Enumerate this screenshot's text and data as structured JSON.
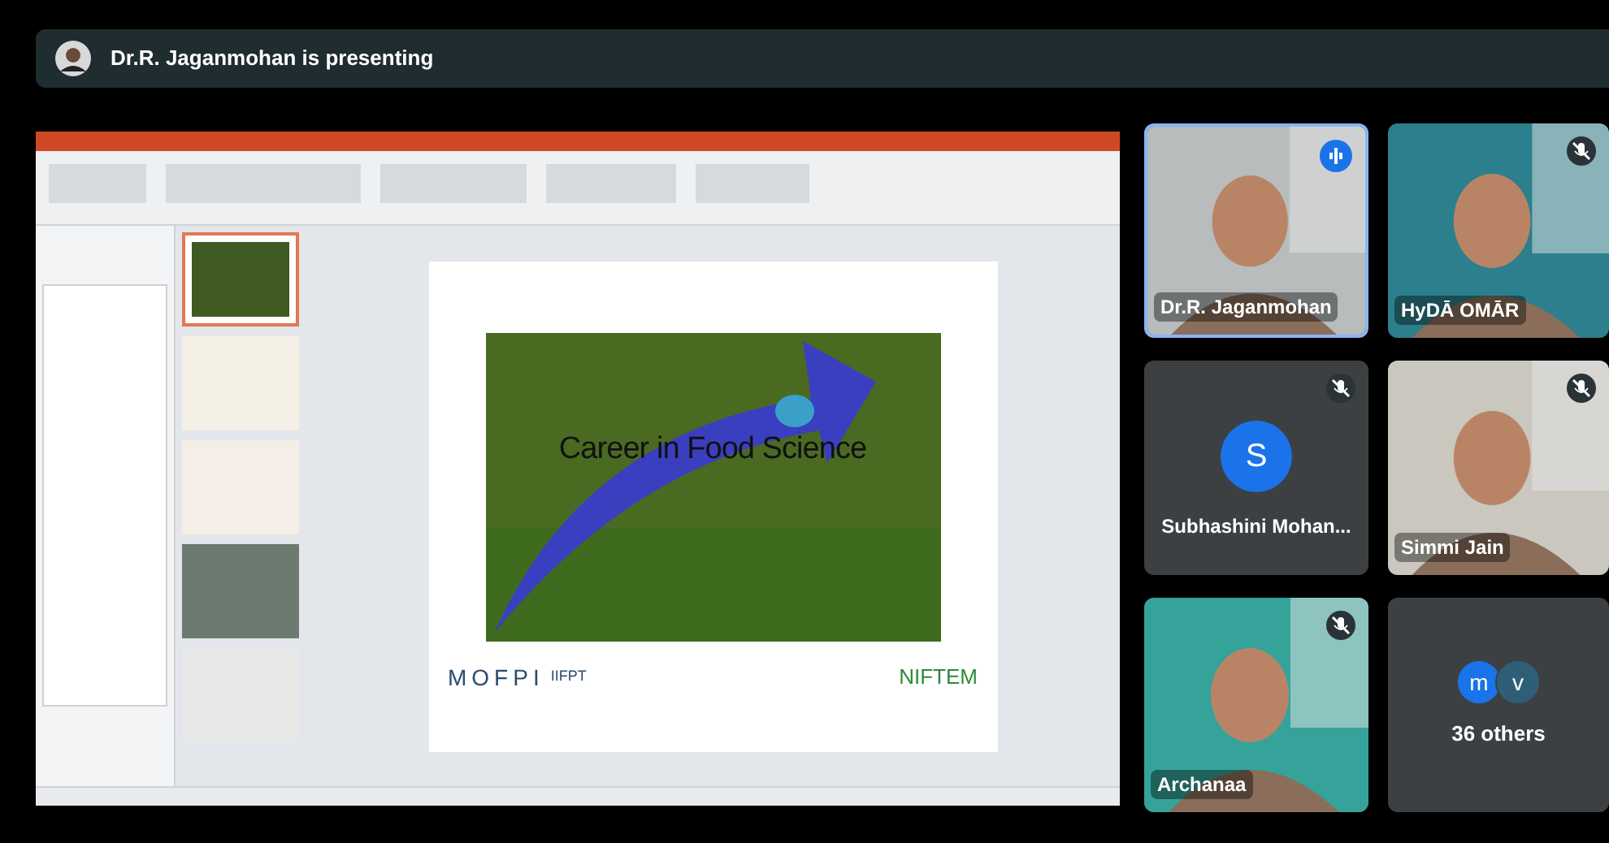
{
  "presenter_bar": {
    "text": "Dr.R. Jaganmohan is presenting"
  },
  "shared_screen": {
    "slide": {
      "title": "Career in Food Science",
      "logos": [
        "MOFPI",
        "IIFPT",
        "NIFTEM"
      ]
    }
  },
  "tiles": [
    {
      "kind": "video",
      "name": "Dr.R. Jaganmohan",
      "muted": false,
      "speaking": true,
      "color": "#b8bcbc"
    },
    {
      "kind": "video",
      "name": "HyDĀ OMĀR",
      "muted": true,
      "speaking": false,
      "color": "#2c7f8c"
    },
    {
      "kind": "avatar",
      "name": "Subhashini Mohan...",
      "initial": "S",
      "muted": true,
      "speaking": false
    },
    {
      "kind": "video",
      "name": "Simmi Jain",
      "muted": true,
      "speaking": false,
      "color": "#c9c7be"
    },
    {
      "kind": "video",
      "name": "Archanaa",
      "muted": true,
      "speaking": false,
      "color": "#35a39a"
    },
    {
      "kind": "others",
      "label": "36 others",
      "initials": [
        "m",
        "v"
      ]
    }
  ]
}
